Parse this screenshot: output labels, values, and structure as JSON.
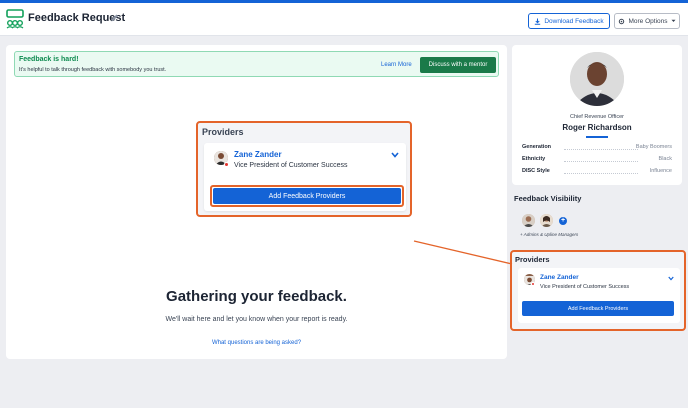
{
  "header": {
    "title": "Feedback Request",
    "download_label": "Download Feedback",
    "more_label": "More Options"
  },
  "banner": {
    "title": "Feedback is hard!",
    "text": "It's helpful to talk through feedback with somebody you trust.",
    "learn_more": "Learn More",
    "mentor_button": "Discuss with a mentor"
  },
  "providers": {
    "title": "Providers",
    "provider_name": "Zane Zander",
    "provider_role": "Vice President of Customer Success",
    "add_button": "Add Feedback Providers"
  },
  "status": {
    "heading": "Gathering your feedback.",
    "subtext": "We'll wait here and let you know when your report is ready.",
    "questions_link": "What questions are being asked?"
  },
  "profile": {
    "job_title": "Chief Revenue Officer",
    "name": "Roger Richardson",
    "attributes": [
      {
        "label": "Generation",
        "value": "Baby Boomers"
      },
      {
        "label": "Ethnicity",
        "value": "Black"
      },
      {
        "label": "DISC Style",
        "value": "Influence"
      }
    ]
  },
  "visibility": {
    "title": "Feedback Visibility",
    "note": "+ Admins & Upline Managers"
  },
  "colors": {
    "primary": "#1463d6",
    "mentor_green": "#1a7a49",
    "highlight_orange": "#e4642a",
    "banner_bg": "#eafaf2"
  },
  "icons": [
    "logo-icon",
    "pencil-icon",
    "download-icon",
    "gear-icon",
    "chevron-down-icon",
    "plus-icon"
  ]
}
